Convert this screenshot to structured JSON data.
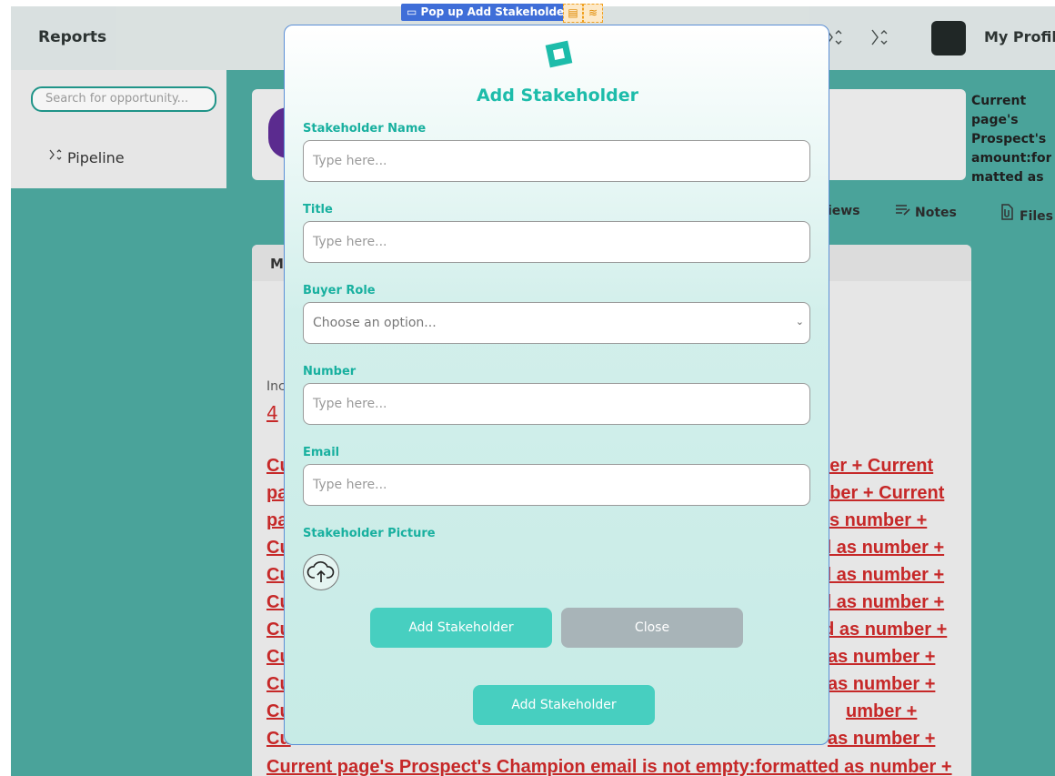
{
  "topbar": {
    "reports_label": "Reports",
    "profile_label": "My Profile"
  },
  "sidebar": {
    "search_placeholder": "Search for opportunity...",
    "pipeline_label": "Pipeline"
  },
  "side_note": "Current page's Prospect's amount:for matted as",
  "tabs": [
    {
      "label": "iews"
    },
    {
      "label": "Notes"
    },
    {
      "label": "Files"
    }
  ],
  "panel": {
    "header": "M",
    "in_label": "Inc",
    "in_value": "4",
    "red_lines": [
      {
        "left": "Cu",
        "right": "ber + Current"
      },
      {
        "left": "pa",
        "right": "nber + Current"
      },
      {
        "left": "pa",
        "right": "s number +"
      },
      {
        "left": "Cu",
        "right": "d as number +"
      },
      {
        "left": "Cu",
        "right": "d as number +"
      },
      {
        "left": "Cu",
        "right": "d as number +"
      },
      {
        "left": "Cu",
        "right": "ed as number +"
      },
      {
        "left": "Cu",
        "right": "as number +"
      },
      {
        "left": "Cu",
        "right": "as number +"
      },
      {
        "left": "Cu",
        "right": "umber +"
      },
      {
        "left": "Cu",
        "right": "as number +"
      }
    ],
    "bottom_line": "Current page's Prospect's Champion email is not empty:formatted as number +"
  },
  "selection": {
    "label": "Pop up Add Stakeholder..."
  },
  "modal": {
    "title": "Add Stakeholder",
    "fields": {
      "name": {
        "label": "Stakeholder Name",
        "placeholder": "Type here..."
      },
      "title": {
        "label": "Title",
        "placeholder": "Type here..."
      },
      "buyer_role": {
        "label": "Buyer Role",
        "value": "Choose an option..."
      },
      "number": {
        "label": "Number",
        "placeholder": "Type here..."
      },
      "email": {
        "label": "Email",
        "placeholder": "Type here..."
      }
    },
    "picture_label": "Stakeholder Picture",
    "add_button": "Add Stakeholder",
    "close_button": "Close",
    "bottom_button": "Add Stakeholder",
    "accent": "#1dbcaa",
    "button_color": "#47cfc0"
  }
}
